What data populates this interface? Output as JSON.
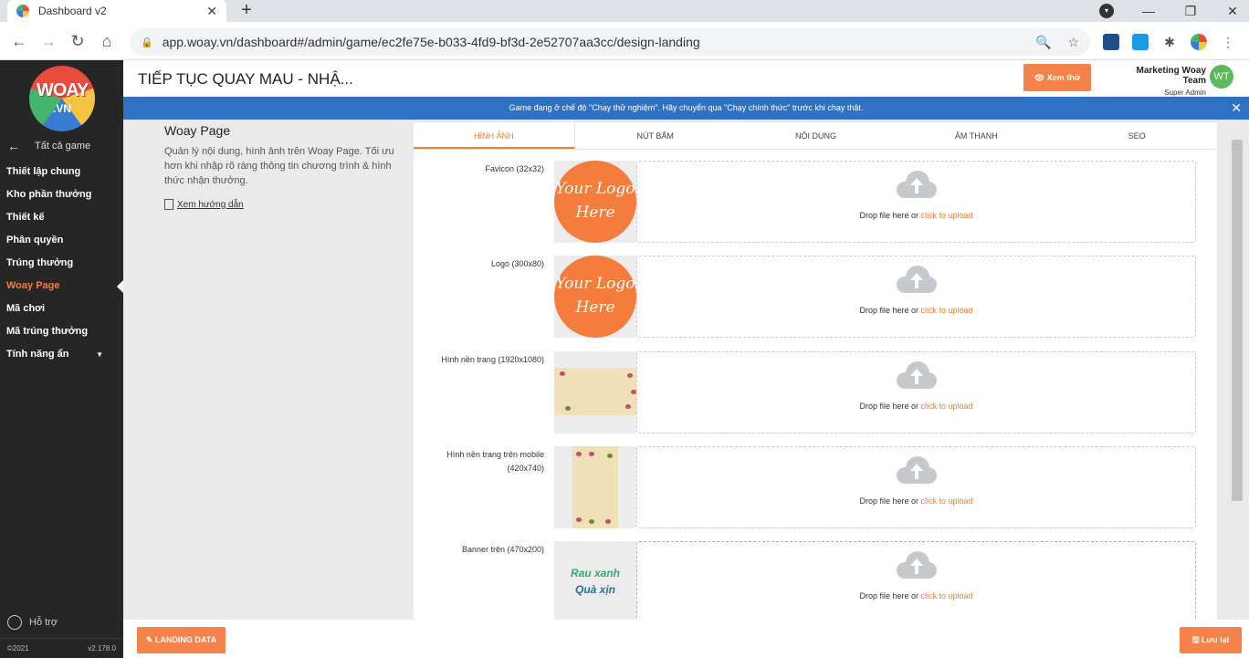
{
  "browser": {
    "tab_title": "Dashboard v2",
    "tab_close": "✕",
    "new_tab": "+",
    "url": "app.woay.vn/dashboard#/admin/game/ec2fe75e-b033-4fd9-bf3d-2e52707aa3cc/design-landing"
  },
  "sidebar": {
    "logo_text": "WOAY",
    "logo_sub": ".VN",
    "back_label": "Tất cả game",
    "items": [
      {
        "label": "Thiết lập chung"
      },
      {
        "label": "Kho phần thưởng"
      },
      {
        "label": "Thiết kế"
      },
      {
        "label": "Phân quyền"
      },
      {
        "label": "Trúng thưởng"
      },
      {
        "label": "Woay Page",
        "active": true
      },
      {
        "label": "Mã chơi"
      },
      {
        "label": "Mã trúng thưởng"
      },
      {
        "label": "Tính năng ẩn"
      }
    ],
    "support": "Hỗ trợ",
    "copyright": "©2021",
    "version": "v2.178.0"
  },
  "header": {
    "title": "TIẾP TỤC QUAY MAU - NHẬ...",
    "preview_button": "👁 Xem thử",
    "user_name": "Marketing Woay Team",
    "user_role": "Super Admin",
    "avatar_initials": "WT"
  },
  "notice": {
    "text": "Game đang ở chế độ \"Chạy thử nghiệm\". Hãy chuyển qua \"Chạy chính thức\" trước khi chạy thật.",
    "close": "✕"
  },
  "info": {
    "title": "Woay Page",
    "description": "Quản lý nội dung, hình ảnh trên Woay Page. Tối ưu hơn khi nhập rõ ràng thông tin chương trình & hình thức nhận thưởng.",
    "guide_link": "Xem hướng dẫn"
  },
  "tabs": [
    "HÌNH ẢNH",
    "NÚT BẤM",
    "NỘI DUNG",
    "ÂM THANH",
    "SEO"
  ],
  "upload": {
    "drop_text": "Drop file here or ",
    "link_text": "click to upload"
  },
  "assets": [
    {
      "label": "Favicon (32x32)",
      "preview": "Your Logo Here"
    },
    {
      "label": "Logo (300x80)",
      "preview": "Your Logo Here"
    },
    {
      "label": "Hình nền trang (1920x1080)"
    },
    {
      "label": "Hình nền trang trên mobile (420x740)"
    },
    {
      "label": "Banner trên (470x200)",
      "preview_line1": "Rau xanh",
      "preview_line2": "Quà xịn"
    }
  ],
  "footer": {
    "landing_button": "✎ LANDING DATA",
    "save_button": "🖫 Lưu lại"
  },
  "colors": {
    "accent": "#f47c3c",
    "notice": "#2f72c4",
    "sidebar": "#262626"
  }
}
